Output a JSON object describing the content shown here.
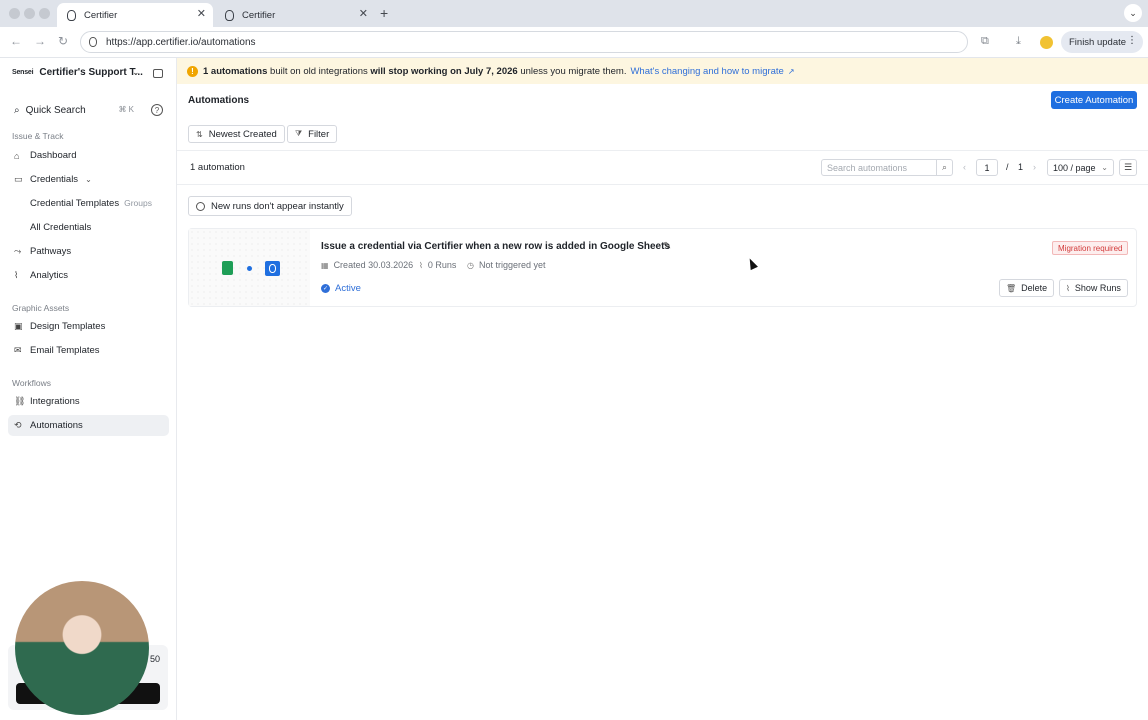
{
  "browser": {
    "tabs": [
      {
        "title": "Certifier"
      },
      {
        "title": "Certifier"
      }
    ],
    "url": "https://app.certifier.io/automations",
    "finish_update": "Finish update"
  },
  "sidebar": {
    "org_logo": "Sensei",
    "org_name": "Certifier's Support T...",
    "search_label": "Quick Search",
    "search_shortcut": "⌘ K",
    "sections": {
      "issue_track": "Issue & Track",
      "graphic_assets": "Graphic Assets",
      "workflows": "Workflows"
    },
    "items": {
      "dashboard": "Dashboard",
      "credentials": "Credentials",
      "credential_templates": "Credential Templates",
      "groups": "Groups",
      "all_credentials": "All Credentials",
      "pathways": "Pathways",
      "analytics": "Analytics",
      "design_templates": "Design Templates",
      "email_templates": "Email Templates",
      "integrations": "Integrations",
      "automations": "Automations"
    },
    "webcam_number": "50"
  },
  "banner": {
    "part1": "1 automations",
    "part2": " built on old integrations ",
    "part3": "will stop working on July 7, 2026",
    "part4": " unless you migrate them.",
    "link": "What's changing and how to migrate"
  },
  "main": {
    "title": "Automations",
    "create_button": "Create Automation",
    "sort_button": "Newest Created",
    "filter_button": "Filter",
    "count": "1 automation",
    "search_placeholder": "Search automations",
    "page_current": "1",
    "page_separator": "/",
    "page_total": "1",
    "per_page": "100 / page",
    "info_chip": "New runs don't appear instantly"
  },
  "automation": {
    "title": "Issue a credential via Certifier when a new row is added in Google Sheets",
    "created": "Created 30.03.2026",
    "runs": "0 Runs",
    "trigger": "Not triggered yet",
    "status": "Active",
    "badge": "Migration required",
    "delete": "Delete",
    "show_runs": "Show Runs"
  }
}
